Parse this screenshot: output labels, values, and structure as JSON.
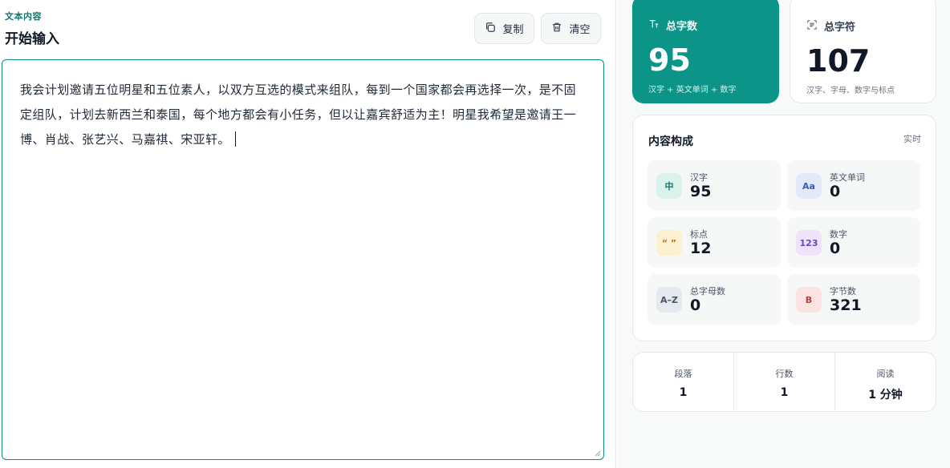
{
  "editor_panel": {
    "section_label": "文本内容",
    "title": "开始输入",
    "copy_label": "复制",
    "clear_label": "清空",
    "text": "我会计划邀请五位明星和五位素人，以双方互选的模式来组队，每到一个国家都会再选择一次，是不固定组队，计划去新西兰和泰国，每个地方都会有小任务，但以让嘉宾舒适为主！明星我希望是邀请王一博、肖战、张艺兴、马嘉祺、宋亚轩。"
  },
  "stats": {
    "total_words": {
      "label": "总字数",
      "value": "95",
      "sub": "汉字 + 英文单词 + 数字",
      "icon": "text-size-icon"
    },
    "total_chars": {
      "label": "总字符",
      "value": "107",
      "sub": "汉字、字母、数字与标点",
      "icon": "scan-text-icon"
    }
  },
  "breakdown": {
    "title": "内容构成",
    "live": "实时",
    "items": [
      {
        "icon_text": "中",
        "label": "汉字",
        "value": "95"
      },
      {
        "icon_text": "Aa",
        "label": "英文单词",
        "value": "0"
      },
      {
        "icon_text": "“ ”",
        "label": "标点",
        "value": "12"
      },
      {
        "icon_text": "123",
        "label": "数字",
        "value": "0"
      },
      {
        "icon_text": "A–Z",
        "label": "总字母数",
        "value": "0"
      },
      {
        "icon_text": "B",
        "label": "字节数",
        "value": "321"
      }
    ]
  },
  "footer": [
    {
      "label": "段落",
      "value": "1"
    },
    {
      "label": "行数",
      "value": "1"
    },
    {
      "label": "阅读",
      "value": "1 分钟"
    }
  ],
  "colors": {
    "accent": "#0d9488",
    "accent_dark": "#0f766e",
    "panel_bg": "#f7faf9"
  }
}
